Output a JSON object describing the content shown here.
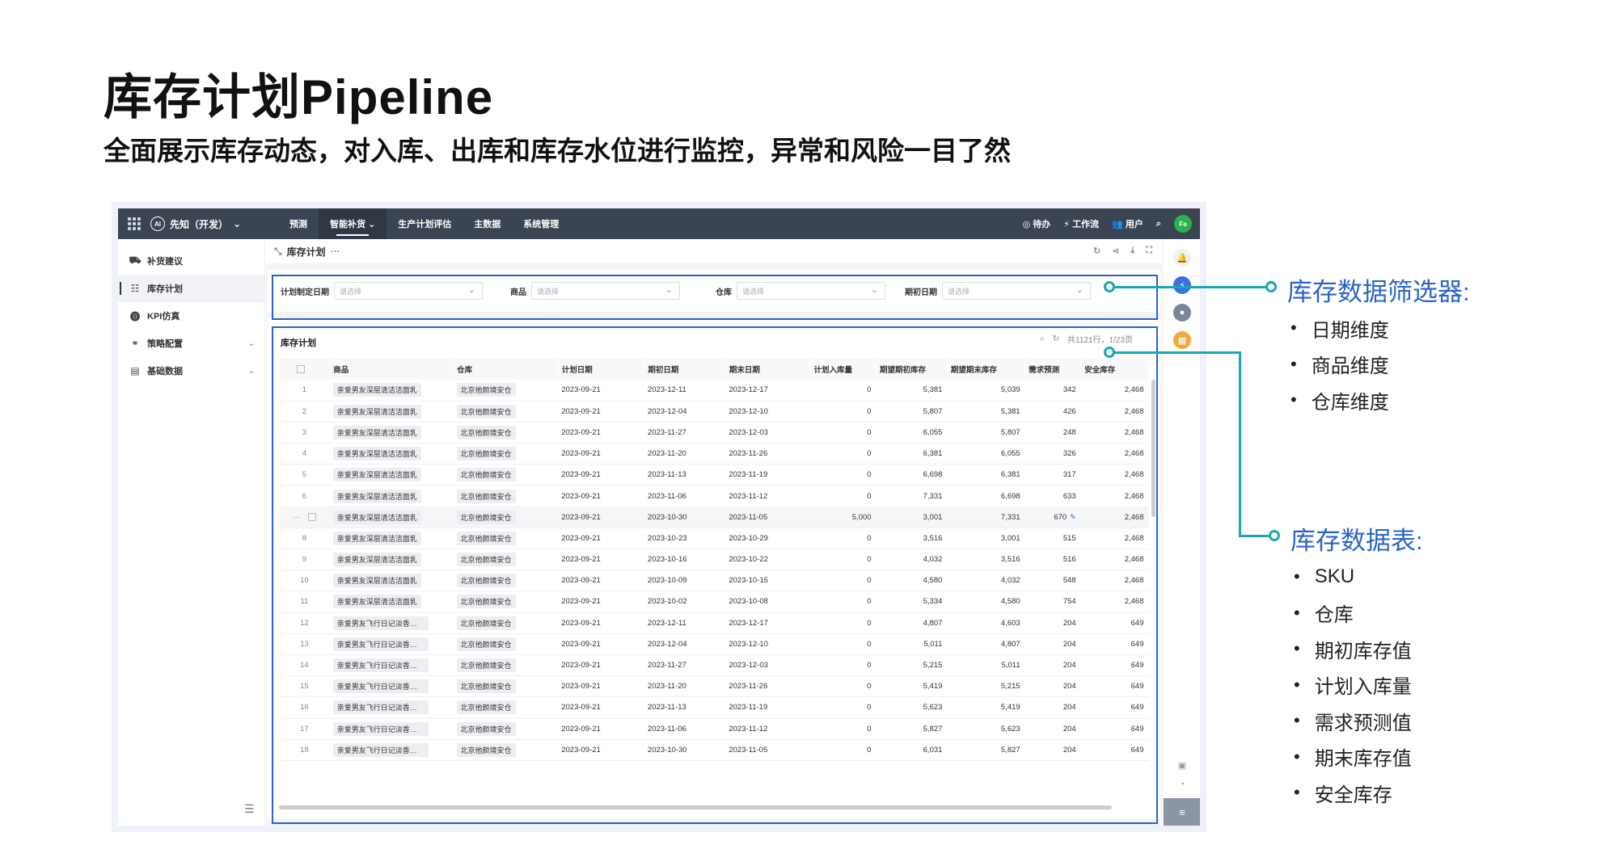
{
  "slide": {
    "title": "库存计划Pipeline",
    "subtitle": "全面展示库存动态，对入库、出库和库存水位进行监控，异常和风险一目了然"
  },
  "app": {
    "brand": "先知（开发）",
    "brand_badge": "AI",
    "nav": [
      "预测",
      "智能补货",
      "生产计划评估",
      "主数据",
      "系统管理"
    ],
    "nav_active_index": 1,
    "top_right": {
      "todo": "待办",
      "workbench": "工作流",
      "user": "用户",
      "avatar": "Fa"
    },
    "sidebar": [
      {
        "label": "补货建议",
        "icon": "truck-icon"
      },
      {
        "label": "库存计划",
        "icon": "bar-list-icon",
        "active": true
      },
      {
        "label": "KPI仿真",
        "icon": "kpi-icon"
      },
      {
        "label": "策略配置",
        "icon": "link-icon",
        "expandable": true
      },
      {
        "label": "基础数据",
        "icon": "document-icon",
        "expandable": true
      }
    ],
    "page_title": "库存计划",
    "filters": [
      {
        "label": "计划制定日期",
        "placeholder": "请选择"
      },
      {
        "label": "商品",
        "placeholder": "请选择"
      },
      {
        "label": "仓库",
        "placeholder": "请选择"
      },
      {
        "label": "期初日期",
        "placeholder": "请选择"
      }
    ],
    "table": {
      "title": "库存计划",
      "pagination": "共1121行，1/23页",
      "columns": [
        "",
        "商品",
        "仓库",
        "计划日期",
        "期初日期",
        "期末日期",
        "计划入库量",
        "期望期初库存",
        "期望期末库存",
        "需求预测",
        "安全库存"
      ],
      "rows": [
        [
          "1",
          "亲爱男友深层清洁洁面乳",
          "北京他颜境安仓",
          "2023-09-21",
          "2023-12-11",
          "2023-12-17",
          "0",
          "5,381",
          "5,039",
          "342",
          "2,468"
        ],
        [
          "2",
          "亲爱男友深层清洁洁面乳",
          "北京他颜境安仓",
          "2023-09-21",
          "2023-12-04",
          "2023-12-10",
          "0",
          "5,807",
          "5,381",
          "426",
          "2,468"
        ],
        [
          "3",
          "亲爱男友深层清洁洁面乳",
          "北京他颜境安仓",
          "2023-09-21",
          "2023-11-27",
          "2023-12-03",
          "0",
          "6,055",
          "5,807",
          "248",
          "2,468"
        ],
        [
          "4",
          "亲爱男友深层清洁洁面乳",
          "北京他颜境安仓",
          "2023-09-21",
          "2023-11-20",
          "2023-11-26",
          "0",
          "6,381",
          "6,055",
          "326",
          "2,468"
        ],
        [
          "5",
          "亲爱男友深层清洁洁面乳",
          "北京他颜境安仓",
          "2023-09-21",
          "2023-11-13",
          "2023-11-19",
          "0",
          "6,698",
          "6,381",
          "317",
          "2,468"
        ],
        [
          "6",
          "亲爱男友深层清洁洁面乳",
          "北京他颜境安仓",
          "2023-09-21",
          "2023-11-06",
          "2023-11-12",
          "0",
          "7,331",
          "6,698",
          "633",
          "2,468"
        ],
        [
          "···",
          "亲爱男友深层清洁洁面乳",
          "北京他颜境安仓",
          "2023-09-21",
          "2023-10-30",
          "2023-11-05",
          "5,000",
          "3,001",
          "7,331",
          "670",
          "2,468"
        ],
        [
          "8",
          "亲爱男友深层清洁洁面乳",
          "北京他颜境安仓",
          "2023-09-21",
          "2023-10-23",
          "2023-10-29",
          "0",
          "3,516",
          "3,001",
          "515",
          "2,468"
        ],
        [
          "9",
          "亲爱男友深层清洁洁面乳",
          "北京他颜境安仓",
          "2023-09-21",
          "2023-10-16",
          "2023-10-22",
          "0",
          "4,032",
          "3,516",
          "516",
          "2,468"
        ],
        [
          "10",
          "亲爱男友深层清洁洁面乳",
          "北京他颜境安仓",
          "2023-09-21",
          "2023-10-09",
          "2023-10-15",
          "0",
          "4,580",
          "4,032",
          "548",
          "2,468"
        ],
        [
          "11",
          "亲爱男友深层清洁洁面乳",
          "北京他颜境安仓",
          "2023-09-21",
          "2023-10-02",
          "2023-10-08",
          "0",
          "5,334",
          "4,580",
          "754",
          "2,468"
        ],
        [
          "12",
          "亲爱男友飞行日记淡香水-...",
          "北京他颜境安仓",
          "2023-09-21",
          "2023-12-11",
          "2023-12-17",
          "0",
          "4,807",
          "4,603",
          "204",
          "649"
        ],
        [
          "13",
          "亲爱男友飞行日记淡香水-...",
          "北京他颜境安仓",
          "2023-09-21",
          "2023-12-04",
          "2023-12-10",
          "0",
          "5,011",
          "4,807",
          "204",
          "649"
        ],
        [
          "14",
          "亲爱男友飞行日记淡香水-...",
          "北京他颜境安仓",
          "2023-09-21",
          "2023-11-27",
          "2023-12-03",
          "0",
          "5,215",
          "5,011",
          "204",
          "649"
        ],
        [
          "15",
          "亲爱男友飞行日记淡香水-...",
          "北京他颜境安仓",
          "2023-09-21",
          "2023-11-20",
          "2023-11-26",
          "0",
          "5,419",
          "5,215",
          "204",
          "649"
        ],
        [
          "16",
          "亲爱男友飞行日记淡香水-...",
          "北京他颜境安仓",
          "2023-09-21",
          "2023-11-13",
          "2023-11-19",
          "0",
          "5,623",
          "5,419",
          "204",
          "649"
        ],
        [
          "17",
          "亲爱男友飞行日记淡香水-...",
          "北京他颜境安仓",
          "2023-09-21",
          "2023-11-06",
          "2023-11-12",
          "0",
          "5,827",
          "5,623",
          "204",
          "649"
        ],
        [
          "18",
          "亲爱男友飞行日记淡香水-...",
          "北京他颜境安仓",
          "2023-09-21",
          "2023-10-30",
          "2023-11-05",
          "0",
          "6,031",
          "5,827",
          "204",
          "649"
        ]
      ],
      "highlighted_row_index": 6
    }
  },
  "callouts": {
    "filter": {
      "title": "库存数据筛选器:",
      "items": [
        "日期维度",
        "商品维度",
        "仓库维度"
      ]
    },
    "table": {
      "title": "库存数据表:",
      "items": [
        "SKU",
        "仓库",
        "期初库存值",
        "计划入库量",
        "需求预测值",
        "期末库存值",
        "安全库存"
      ]
    }
  },
  "colors": {
    "highlight_box": "#2563d6",
    "connector": "#19a7b3",
    "callout_title": "#2a63c9",
    "topbar": "#3a4452"
  }
}
